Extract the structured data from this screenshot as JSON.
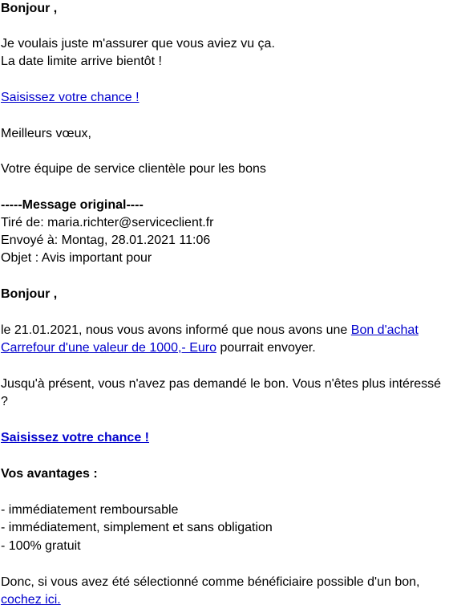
{
  "email": {
    "greeting": "Bonjour ,",
    "intro_line1": "Je voulais juste m'assurer que vous aviez vu ça.",
    "intro_line2": "La date limite arrive bientôt !",
    "cta_link_1": "Saisissez votre chance !",
    "closing": "Meilleurs vœux,",
    "signature": "Votre équipe de service clientèle pour les bons",
    "original": {
      "header": "-----Message original----",
      "from_label": "Tiré de:",
      "from_value": "maria.richter@serviceclient.fr",
      "sent_label": "Envoyé à:",
      "sent_value": "Montag, 28.01.2021 11:06",
      "subject_label": "Objet :",
      "subject_value": "Avis important pour",
      "greeting": "Bonjour ,",
      "body_pre": "le 21.01.2021, nous vous avons informé que nous avons une",
      "voucher_link_part1": "Bon d'achat",
      "voucher_link_part2": "Carrefour d'une valeur de 1000,- Euro",
      "body_post": "pourrait envoyer.",
      "reminder_line1": "Jusqu'à présent, vous n'avez pas demandé le bon. Vous n'êtes plus intéressé",
      "reminder_line2": "?",
      "cta_link_2": "Saisissez votre chance !",
      "advantages_title": "Vos avantages :",
      "advantages": [
        "- immédiatement remboursable",
        "- immédiatement, simplement et sans obligation",
        "- 100% gratuit"
      ],
      "final_line": "Donc, si vous avez été sélectionné comme bénéficiaire possible d'un bon,",
      "final_link": "cochez ici."
    }
  },
  "colors": {
    "link": "#0000cc",
    "text": "#000000",
    "background": "#ffffff"
  }
}
